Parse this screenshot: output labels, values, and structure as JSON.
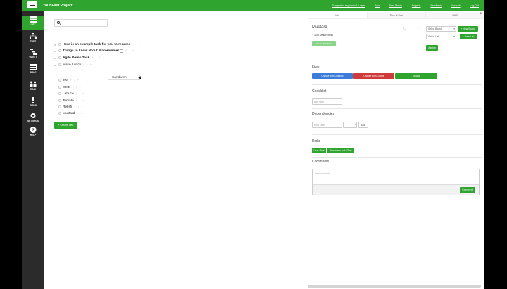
{
  "topbar": {
    "project_title": "Your First Project",
    "links": [
      "Plus period expires in 15 days",
      "Tour",
      "Free Month",
      "Projects",
      "Feedback",
      "Account",
      "Log Out"
    ]
  },
  "rail": {
    "items": [
      {
        "label": "LIST",
        "icon": "list-icon"
      },
      {
        "label": "TREE",
        "icon": "tree-icon"
      },
      {
        "label": "GANTT",
        "icon": "gantt-icon"
      },
      {
        "label": "BOLE",
        "icon": "board-icon"
      },
      {
        "label": "RACI",
        "icon": "raci-icon"
      },
      {
        "label": "RISKS",
        "icon": "exclamation-icon"
      },
      {
        "label": "SETTINGS",
        "icon": "gear-icon"
      },
      {
        "label": "HELP",
        "icon": "help-icon"
      }
    ]
  },
  "main": {
    "search_placeholder": "",
    "tasks": [
      {
        "text": "Here is an example task for you to rename",
        "bold": true,
        "has_children": true
      },
      {
        "text": "Things to know about PlanHammer",
        "bold": true,
        "has_children": true,
        "info": true
      },
      {
        "text": "Agile Demo Task",
        "bold": true,
        "has_children": true
      },
      {
        "text": "Make Lunch",
        "bold": false,
        "has_children": true
      },
      {
        "text": "Tea",
        "bold": false
      },
      {
        "text": "Meat",
        "bold": false
      },
      {
        "text": "Lettuce",
        "bold": false
      },
      {
        "text": "Tomato",
        "bold": false
      },
      {
        "text": "Relish",
        "bold": false
      },
      {
        "text": "Mustard",
        "bold": false
      }
    ],
    "edit_value": "Sandwich",
    "task_controls": "+ ↓ +",
    "create_button": "+ Create Task"
  },
  "panel": {
    "tabs": [
      "Info",
      "Time & Cost",
      "RACI"
    ],
    "close": "×",
    "task_title": "Mustard",
    "header_icons": "▢ ⋯",
    "description_prefix": "+ add",
    "description_link": "Description",
    "small_button": "Create Sub Task",
    "select_board": "Select Board",
    "new_board": "+ New Board",
    "select_list": "Select List",
    "new_list": "+ New List",
    "assign": "Assign",
    "files_title": "Files",
    "file_buttons": [
      {
        "label": "Choose from Dropbox",
        "color": "#3b7dd8"
      },
      {
        "label": "Choose from Google",
        "color": "#cf3b3b"
      },
      {
        "label": "Upload",
        "color": "#2fa52f"
      }
    ],
    "checklist_title": "Checklist",
    "checklist_placeholder": "Add Item",
    "dependencies_title": "Dependencies",
    "dependency_placeholder": "Find Task",
    "dependency_add": "Add",
    "risks_title": "Risks",
    "risk_buttons": [
      "New Risk",
      "Associate with Risk"
    ],
    "comments_title": "Comments",
    "comment_placeholder": "New comment...",
    "comment_button": "Comment"
  },
  "colors": {
    "accent": "#2fa52f",
    "rail": "#2b2b2b"
  }
}
